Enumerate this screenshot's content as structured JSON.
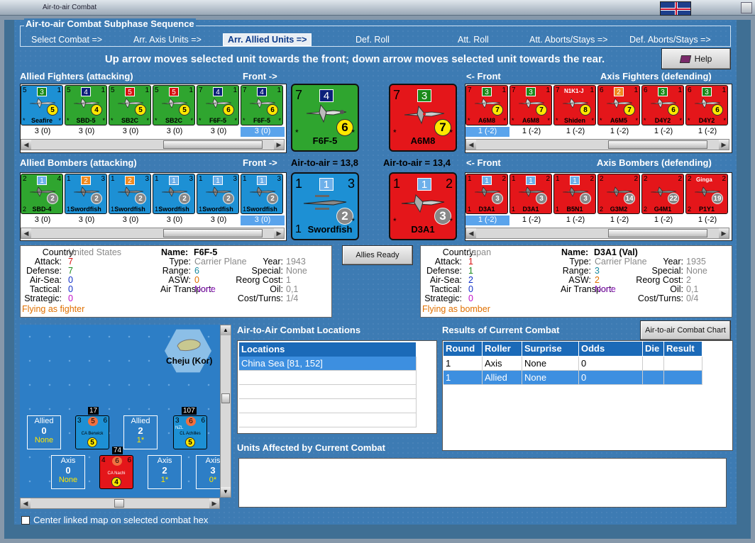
{
  "window": {
    "title": "Air-to-air Combat"
  },
  "sequence": {
    "title": "Air-to-air Combat Subphase Sequence",
    "steps": [
      "Select Combat =>",
      "Arr. Axis Units =>",
      "Arr. Allied Units =>",
      "Def. Roll",
      "Att. Roll",
      "Att. Aborts/Stays =>",
      "Def. Aborts/Stays =>"
    ],
    "active_index": 2
  },
  "instruction": "Up arrow moves selected unit towards the front; down arrow moves selected unit towards the rear.",
  "help_label": "Help",
  "allied_fighters": {
    "title": "Allied Fighters (attacking)",
    "front": "Front ->",
    "units": [
      {
        "name": "Seafire",
        "color": "blue",
        "left": "5",
        "badge": "3",
        "badge_color": "green",
        "right": "1",
        "circle": "5",
        "values": "3 (0)"
      },
      {
        "name": "SBD-5",
        "color": "green",
        "left": "5",
        "badge": "4",
        "badge_color": "navy",
        "right": "1",
        "circle": "4",
        "values": "3 (0)"
      },
      {
        "name": "SB2C",
        "color": "green",
        "left": "5",
        "badge": "5",
        "badge_color": "red",
        "right": "1",
        "circle": "5",
        "values": "3 (0)"
      },
      {
        "name": "SB2C",
        "color": "green",
        "left": "5",
        "badge": "5",
        "badge_color": "red",
        "right": "1",
        "circle": "5",
        "values": "3 (0)"
      },
      {
        "name": "F6F-5",
        "color": "green",
        "left": "7",
        "badge": "4",
        "badge_color": "navy",
        "right": "1",
        "circle": "6",
        "values": "3 (0)"
      },
      {
        "name": "F6F-5",
        "color": "green",
        "left": "7",
        "badge": "4",
        "badge_color": "navy",
        "right": "1",
        "circle": "6",
        "values": "3 (0)"
      }
    ],
    "selected_index": 5
  },
  "axis_fighters": {
    "title": "Axis Fighters (defending)",
    "front": "<- Front",
    "units": [
      {
        "name": "A6M8",
        "color": "red",
        "left": "7",
        "badge": "3",
        "badge_color": "green",
        "right": "1",
        "circle": "7",
        "values": "1 (-2)"
      },
      {
        "name": "A6M8",
        "color": "red",
        "left": "7",
        "badge": "3",
        "badge_color": "green",
        "right": "1",
        "circle": "7",
        "values": "1 (-2)"
      },
      {
        "name": "Shiden",
        "code": "N1K1-J",
        "color": "red",
        "left": "7",
        "badge": "",
        "badge_color": "",
        "right": "1",
        "circle": "8",
        "values": "1 (-2)"
      },
      {
        "name": "A6M5",
        "color": "red",
        "left": "6",
        "badge": "2",
        "badge_color": "orange",
        "right": "1",
        "circle": "7",
        "values": "1 (-2)"
      },
      {
        "name": "D4Y2",
        "color": "red",
        "left": "6",
        "badge": "3",
        "badge_color": "green",
        "right": "1",
        "circle": "6",
        "values": "1 (-2)"
      },
      {
        "name": "D4Y2",
        "color": "red",
        "left": "6",
        "badge": "3",
        "badge_color": "green",
        "right": "1",
        "circle": "6",
        "values": "1 (-2)"
      }
    ],
    "selected_index": 0
  },
  "allied_bombers": {
    "title": "Allied Bombers (attacking)",
    "front": "Front ->",
    "units": [
      {
        "name": "SBD-4",
        "color": "green",
        "left": "2",
        "badge": "1",
        "badge_color": "lightblue",
        "right": "4",
        "circle": "2",
        "values": "3 (0)"
      },
      {
        "name": "Swordfish",
        "color": "blue",
        "left": "1",
        "badge": "2",
        "badge_color": "orange",
        "right": "3",
        "circle": "2",
        "values": "3 (0)"
      },
      {
        "name": "Swordfish",
        "color": "blue",
        "left": "1",
        "badge": "2",
        "badge_color": "orange",
        "right": "3",
        "circle": "2",
        "values": "3 (0)"
      },
      {
        "name": "Swordfish",
        "color": "blue",
        "left": "1",
        "badge": "1",
        "badge_color": "lightblue",
        "right": "3",
        "circle": "2",
        "values": "3 (0)"
      },
      {
        "name": "Swordfish",
        "color": "blue",
        "left": "1",
        "badge": "1",
        "badge_color": "lightblue",
        "right": "3",
        "circle": "2",
        "values": "3 (0)"
      },
      {
        "name": "Swordfish",
        "color": "blue",
        "left": "1",
        "badge": "1",
        "badge_color": "lightblue",
        "right": "3",
        "circle": "2",
        "values": "3 (0)"
      }
    ],
    "selected_index": 5
  },
  "axis_bombers": {
    "title": "Axis Bombers (defending)",
    "front": "<- Front",
    "units": [
      {
        "name": "D3A1",
        "color": "red",
        "left": "1",
        "badge": "1",
        "badge_color": "lightblue",
        "right": "2",
        "circle": "3",
        "values": "1 (-2)"
      },
      {
        "name": "D3A1",
        "color": "red",
        "left": "1",
        "badge": "1",
        "badge_color": "lightblue",
        "right": "2",
        "circle": "3",
        "values": "1 (-2)"
      },
      {
        "name": "B5N1",
        "color": "red",
        "left": "1",
        "badge": "1",
        "badge_color": "lightblue",
        "right": "2",
        "circle": "3",
        "values": "1 (-2)"
      },
      {
        "name": "G3M2",
        "color": "red",
        "left": "2",
        "badge": "",
        "badge_color": "",
        "right": "2",
        "circle": "14",
        "values": "1 (-2)"
      },
      {
        "name": "G4M1",
        "color": "red",
        "left": "2",
        "badge": "",
        "badge_color": "",
        "right": "2",
        "circle": "22",
        "values": "1 (-2)"
      },
      {
        "name": "P1Y1",
        "code": "Ginga",
        "color": "red",
        "left": "2",
        "badge": "",
        "badge_color": "",
        "right": "2",
        "circle": "19",
        "values": "1 (-2)"
      }
    ],
    "selected_index": 0
  },
  "big_allied_fighter": {
    "name": "F6F-5",
    "left": "7",
    "badge": "4",
    "circle": "6"
  },
  "big_axis_fighter": {
    "name": "A6M8",
    "left": "7",
    "badge": "3",
    "circle": "7"
  },
  "big_allied_bomber": {
    "name": "Swordfish",
    "left": "1",
    "badge": "1",
    "right": "3",
    "circle": "2"
  },
  "big_axis_bomber": {
    "name": "D3A1",
    "left": "1",
    "badge": "1",
    "right": "2",
    "circle": "3"
  },
  "air_to_air_allied": "Air-to-air = 13,8",
  "air_to_air_axis": "Air-to-air = 13,4",
  "allies_ready_label": "Allies Ready",
  "allied_info": {
    "country_k": "Country:",
    "country": "United States",
    "attack_k": "Attack:",
    "attack": "7",
    "defense_k": "Defense:",
    "defense": "7",
    "airsea_k": "Air-Sea:",
    "airsea": "0",
    "tactical_k": "Tactical:",
    "tactical": "0",
    "strategic_k": "Strategic:",
    "strategic": "0",
    "name_k": "Name:",
    "name": "F6F-5",
    "type_k": "Type:",
    "type": "Carrier Plane",
    "range_k": "Range:",
    "range": "6",
    "asw_k": "ASW:",
    "asw": "0",
    "airtrans_k": "Air Transport:",
    "airtrans": "None",
    "year_k": "Year:",
    "year": "1943",
    "special_k": "Special:",
    "special": "None",
    "reorg_k": "Reorg Cost:",
    "reorg": "1",
    "oil_k": "Oil:",
    "oil": "0,1",
    "cost_k": "Cost/Turns:",
    "cost": "1/4",
    "status": "Flying as fighter"
  },
  "axis_info": {
    "country_k": "Country:",
    "country": "Japan",
    "attack_k": "Attack:",
    "attack": "1",
    "defense_k": "Defense:",
    "defense": "1",
    "airsea_k": "Air-Sea:",
    "airsea": "2",
    "tactical_k": "Tactical:",
    "tactical": "0",
    "strategic_k": "Strategic:",
    "strategic": "0",
    "name_k": "Name:",
    "name": "D3A1 (Val)",
    "type_k": "Type:",
    "type": "Carrier Plane",
    "range_k": "Range:",
    "range": "3",
    "asw_k": "ASW:",
    "asw": "2",
    "airtrans_k": "Air Transport:",
    "airtrans": "None",
    "year_k": "Year:",
    "year": "1935",
    "special_k": "Special:",
    "special": "None",
    "reorg_k": "Reorg Cost:",
    "reorg": "2",
    "oil_k": "Oil:",
    "oil": "0,1",
    "cost_k": "Cost/Turns:",
    "cost": "0/4",
    "status": "Flying as bomber"
  },
  "map": {
    "hex_label": "Cheju (Kor)",
    "boxes": [
      {
        "title": "Allied",
        "num": "0",
        "sub": "None"
      },
      {
        "title": "Allied",
        "num": "2",
        "sub": "1*"
      },
      {
        "title": "Axis",
        "num": "0",
        "sub": "None"
      },
      {
        "title": "Axis",
        "num": "2",
        "sub": "1*"
      },
      {
        "title": "Axis",
        "num": "3",
        "sub": "0*"
      }
    ],
    "ships": [
      {
        "name": "CA Berwick",
        "l": "3",
        "c": "5",
        "r": "6",
        "b": "5",
        "tag": "17"
      },
      {
        "name": "CL Achilles",
        "l": "3",
        "c": "6",
        "r": "6",
        "b": "5",
        "tag": "107",
        "extra": "NZL"
      },
      {
        "name": "CA Nachi",
        "l": "4",
        "c": "6",
        "r": "6",
        "b": "4",
        "tag": "74"
      }
    ],
    "checkbox_label": "Center linked map on selected combat hex"
  },
  "locations": {
    "title": "Air-to-Air Combat Locations",
    "header": "Locations",
    "rows": [
      "China Sea [81, 152]"
    ]
  },
  "results": {
    "title": "Results of Current Combat",
    "chart_button": "Air-to-air Combat Chart",
    "headers": [
      "Round",
      "Roller",
      "Surprise",
      "Odds",
      "Die",
      "Result"
    ],
    "rows": [
      [
        "1",
        "Axis",
        "None",
        "0",
        "",
        ""
      ],
      [
        "1",
        "Allied",
        "None",
        "0",
        "",
        ""
      ]
    ],
    "selected_row": 1
  },
  "affected": {
    "title": "Units Affected by Current Combat"
  }
}
